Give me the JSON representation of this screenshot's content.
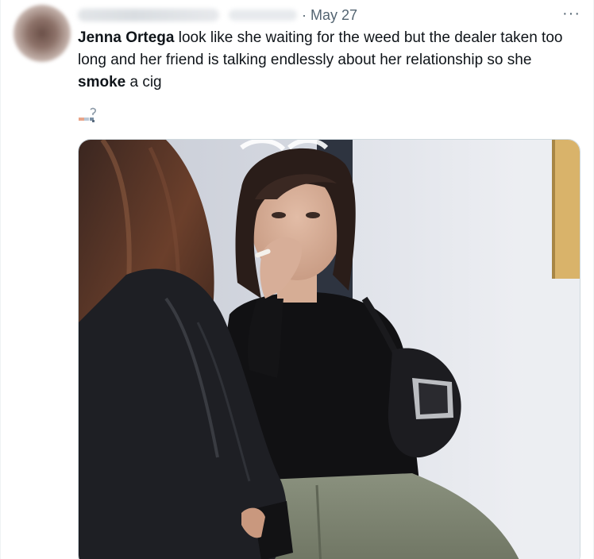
{
  "tweet": {
    "date_prefix": "·",
    "date": "May 27",
    "more_label": "···",
    "text": {
      "mention": "Jenna Ortega",
      "part1": " look like she waiting for the weed but the dealer taken too long and her friend is talking endlessly about her relationship so she ",
      "emphasis": "smoke",
      "part2": " a cig"
    },
    "emoji_icon": "broken-image-icon"
  },
  "media": {
    "type": "photo",
    "alt": ""
  }
}
